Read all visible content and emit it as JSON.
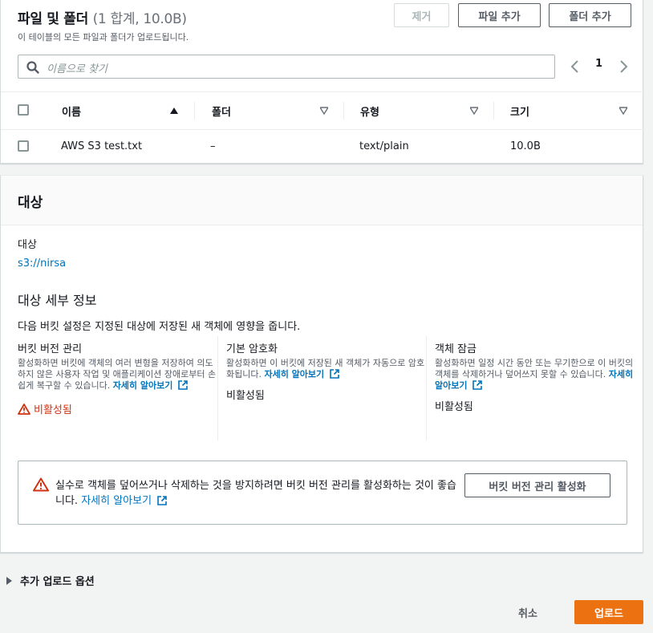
{
  "files": {
    "title": "파일 및 폴더",
    "count": "(1 합계, 10.0B)",
    "description": "이 테이블의 모든 파일과 폴더가 업로드됩니다.",
    "remove_label": "제거",
    "add_files_label": "파일 추가",
    "add_folder_label": "폴더 추가",
    "search_placeholder": "이름으로 찾기",
    "page_number": "1",
    "columns": [
      "이름",
      "폴더",
      "유형",
      "크기"
    ],
    "rows": [
      {
        "name": "AWS S3 test.txt",
        "folder": "–",
        "type": "text/plain",
        "size": "10.0B"
      }
    ]
  },
  "destination": {
    "title": "대상",
    "label": "대상",
    "value": "s3://nirsa",
    "details_title": "대상 세부 정보",
    "details_desc": "다음 버킷 설정은 지정된 대상에 저장된 새 객체에 영향을 줍니다.",
    "learn_more": "자세히 알아보기",
    "versioning": {
      "title": "버킷 버전 관리",
      "desc": "활성화하면 버킷에 객체의 여러 변형을 저장하여 의도하지 않은 사용자 작업 및 애플리케이션 장애로부터 손쉽게 복구할 수 있습니다.",
      "state": "비활성됨"
    },
    "encryption": {
      "title": "기본 암호화",
      "desc": "활성화하면 이 버킷에 저장된 새 객체가 자동으로 암호화됩니다.",
      "state": "비활성됨"
    },
    "lock": {
      "title": "객체 잠금",
      "desc": "활성화하면 일정 시간 동안 또는 무기한으로 이 버킷의 객체를 삭제하거나 덮어쓰지 못할 수 있습니다.",
      "state": "비활성됨"
    },
    "alert_text": "실수로 객체를 덮어쓰거나 삭제하는 것을 방지하려면 버킷 버전 관리를 활성화하는 것이 좋습니다.",
    "enable_versioning_label": "버킷 버전 관리 활성화"
  },
  "footer": {
    "options_label": "추가 업로드 옵션",
    "cancel_label": "취소",
    "upload_label": "업로드"
  },
  "colors": {
    "accent": "#ec7211",
    "link": "#0073bb",
    "warning": "#d13212"
  }
}
